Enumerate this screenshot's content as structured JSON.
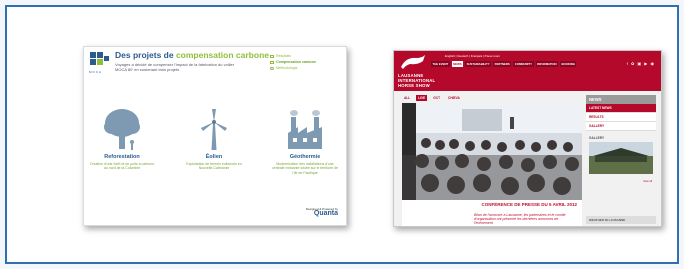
{
  "left_panel": {
    "title_part1": "Des projets de ",
    "title_part2": "compensation carbone",
    "intro": "Voyages a décidé de compenser l'impact de la fabrication du voilier MOCA 80' en soutenant trois projets",
    "nav": [
      "Résultats",
      "Compensation carbone",
      "Méthodologie"
    ],
    "logo_text": "MOCA",
    "columns": [
      {
        "icon": "tree-icon",
        "title": "Reforestation",
        "desc": "Création d'une forêt et de puits à carbone au nord de la Colombie"
      },
      {
        "icon": "wind-turbine-icon",
        "title": "Éolien",
        "desc": "Exploitation de fermes éoliennes en Nouvelle-Calédonie"
      },
      {
        "icon": "factory-icon",
        "title": "Géothermie",
        "desc": "Modernisation des installations d'une centrale existante située sur le territoire de l'île de Pacifique"
      }
    ],
    "footer_small": "Designed & Powered by",
    "footer_brand": "Quanta"
  },
  "right_panel": {
    "brand_lines": [
      "LAUSANNE",
      "INTERNATIONAL",
      "HORSE SHOW"
    ],
    "lang": "English  |  Deutsch  |  Français  |  Press room",
    "menu": [
      "THE EVENT",
      "NEWS",
      "SUSTAINABILITY",
      "PARTNERS",
      "COMMUNITY",
      "INFORMATION",
      "BOOKING"
    ],
    "active_menu": "NEWS",
    "social": "f ✿ ▣ ▶ ◉",
    "tabs": [
      "ALL",
      "LIVE",
      "GCT",
      "CHIEVA"
    ],
    "active_tab": "LIVE",
    "caption_title": "CONFÉRENCE DE PRESSE DU 5 AVRIL 2012",
    "caption_body": "Bilan de l'annonce à Lausanne, les partenaires et le comité d'organisation ont présenté les dernières annonces de l'événement",
    "side_header": "NEWS",
    "side_items": [
      "LATEST NEWS",
      "RESULTS",
      "GALLERY"
    ],
    "gallery_label": "GALLERY",
    "more_label": "View all",
    "weather_label": "WEATHER IN LAUSANNE",
    "colors": {
      "brand": "#b5092b",
      "accent_green": "#8fbf3a",
      "blue": "#2a5c8f"
    }
  }
}
